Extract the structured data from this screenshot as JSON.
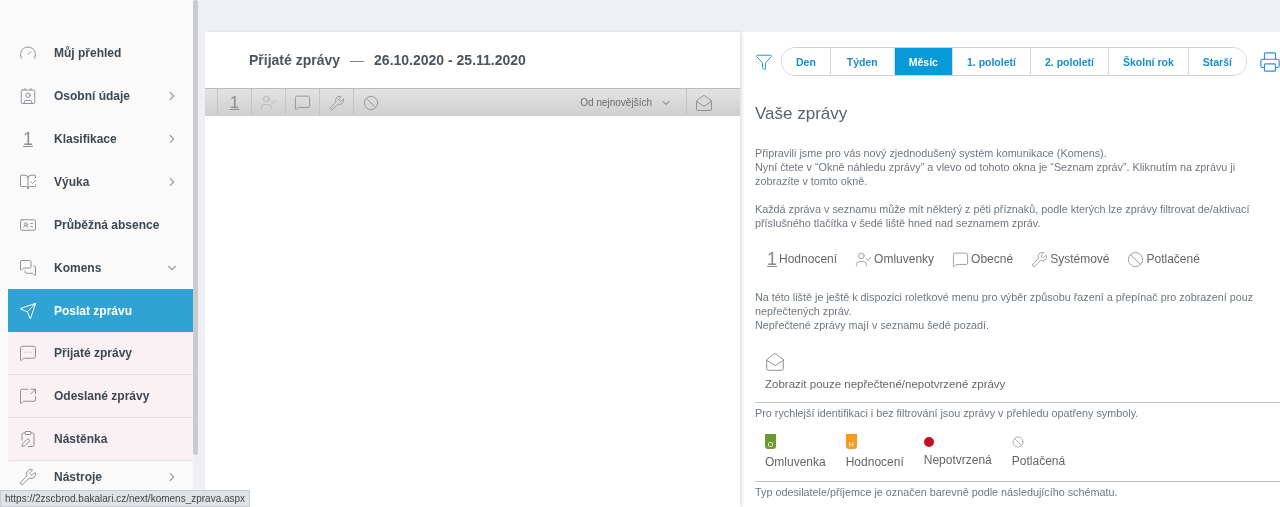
{
  "sidebar": {
    "items": [
      {
        "label": "Můj přehled",
        "selected": false
      },
      {
        "label": "Osobní údaje",
        "expanded": false,
        "selected": false
      },
      {
        "label": "Klasifikace",
        "glyph": "1",
        "expanded": false,
        "selected": false
      },
      {
        "label": "Výuka",
        "expanded": false,
        "selected": false
      },
      {
        "label": "Průběžná absence",
        "selected": false
      },
      {
        "label": "Komens",
        "expanded": true,
        "selected": false,
        "children": [
          {
            "label": "Poslat zprávu",
            "selected": true
          },
          {
            "label": "Přijaté zprávy",
            "selected": false
          },
          {
            "label": "Odeslané zprávy",
            "selected": false
          },
          {
            "label": "Nástěnka",
            "selected": false
          }
        ]
      },
      {
        "label": "Nástroje",
        "expanded": false,
        "selected": false
      }
    ]
  },
  "list": {
    "title": "Přijaté zprávy",
    "separator": "—",
    "range": "26.10.2020 - 25.11.2020",
    "toolbar": {
      "grade_glyph": "1",
      "sort": "Od nejnovějších"
    }
  },
  "periods": [
    {
      "label": "Den",
      "selected": false
    },
    {
      "label": "Týden",
      "selected": false
    },
    {
      "label": "Měsíc",
      "selected": true
    },
    {
      "label": "1. pololetí",
      "selected": false
    },
    {
      "label": "2. pololetí",
      "selected": false
    },
    {
      "label": "Školní rok",
      "selected": false
    },
    {
      "label": "Starší",
      "selected": false
    }
  ],
  "help": {
    "heading": "Vaše zprávy",
    "intro": [
      "Připravili jsme pro vás nový zjednodušený systém komunikace (Komens).",
      "Nyní čtete v “Okně náhledu zprávy” a vlevo od tohoto okna je “Seznam zpráv”. Kliknutím na zprávu ji",
      "zobrazíte v tomto okně."
    ],
    "flags_text": [
      "Každá zpráva v seznamu může mít některý z pěti příznaků, podle kterých lze zprávy filtrovat de/aktivací",
      "příslušného tlačítka v šedé liště hned nad seznamem zpráv."
    ],
    "flags": [
      {
        "glyph": "1",
        "label": "Hodnocení"
      },
      {
        "label": "Omluvenky"
      },
      {
        "label": "Obecné"
      },
      {
        "label": "Systémové"
      },
      {
        "label": "Potlačené"
      }
    ],
    "sort_text": [
      "Na této liště je ještě k dispozici roletkové menu pro výběr způsobu řazení a přepínač pro zobrazení pouz",
      "nepřečtených zpráv.",
      "Nepřečtené zprávy mají v seznamu šedé pozadí."
    ],
    "unread_toggle": "Zobrazit pouze nepřečtené/nepotvrzené zprávy",
    "symbols_text": "Pro rychlejší identifikaci i bez filtrování jsou zprávy v přehledu opatřeny symboly.",
    "symbols": [
      {
        "kind": "badge",
        "badge": "O",
        "color": "#6b9a2f",
        "label": "Omluvenka"
      },
      {
        "kind": "badge",
        "badge": "H",
        "color": "#f29b1c",
        "label": "Hodnocení"
      },
      {
        "kind": "dot",
        "color": "#c5101f",
        "label": "Nepotvrzená"
      },
      {
        "kind": "ban",
        "label": "Potlačená"
      }
    ],
    "scheme_text": "Typ odesilatele/příjemce je označen barevně podle následujícího schématu."
  },
  "status_url": "https://2zscbrod.bakalari.cz/next/komens_zprava.aspx"
}
